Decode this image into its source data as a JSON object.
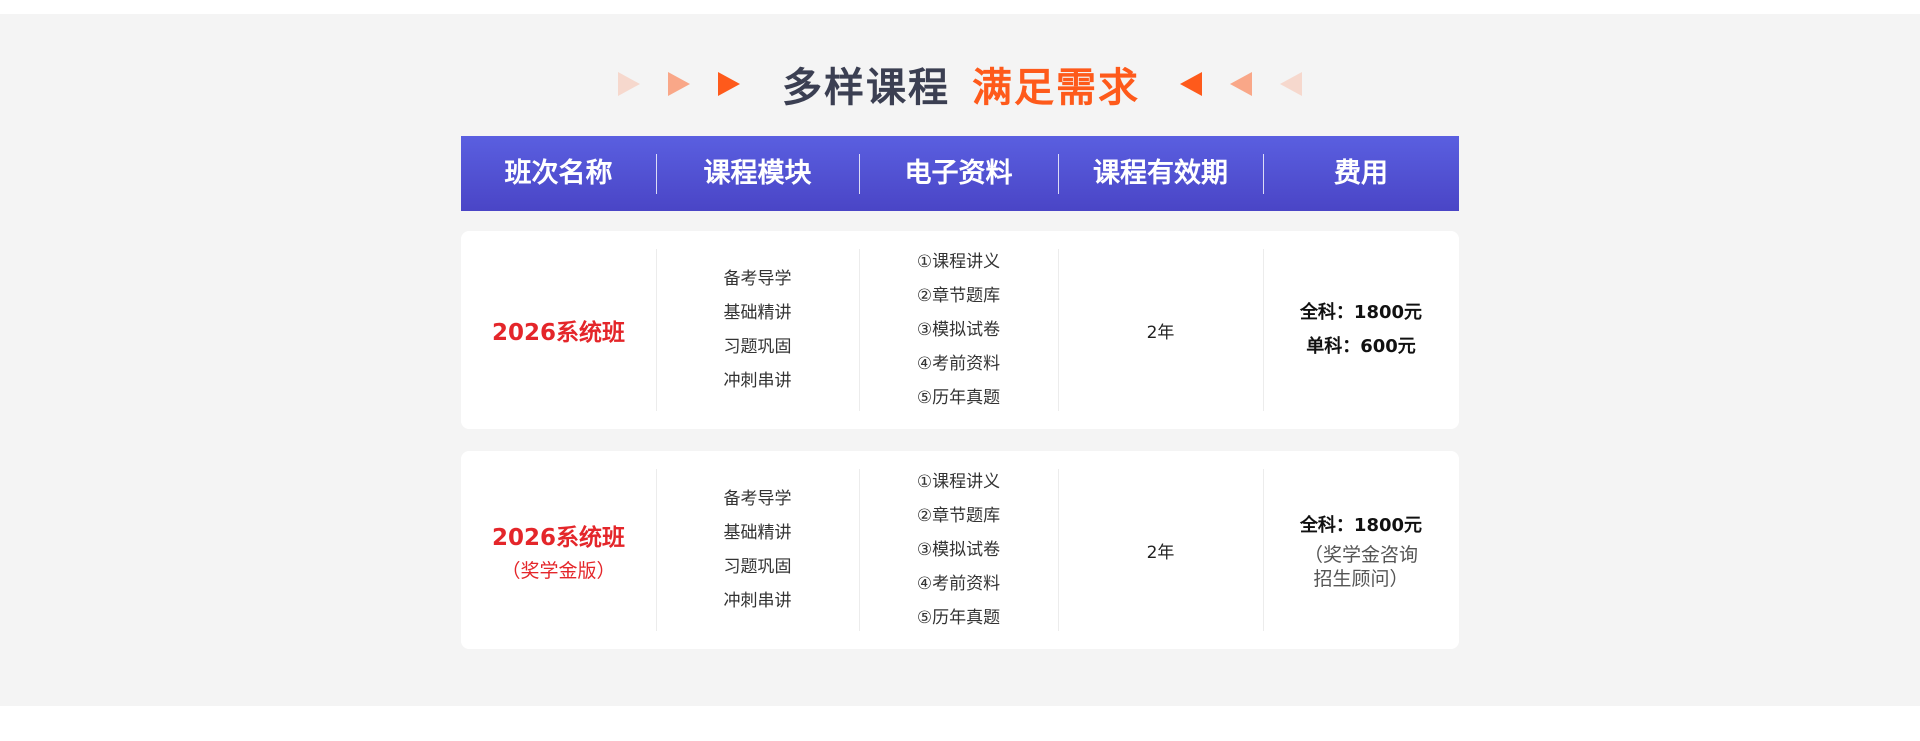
{
  "headline": {
    "title_dark": "多样课程",
    "title_accent": "满足需求"
  },
  "table": {
    "headers": [
      "班次名称",
      "课程模块",
      "电子资料",
      "课程有效期",
      "费用"
    ],
    "rows": [
      {
        "name": "2026系统班",
        "subtitle": "",
        "modules": [
          "备考导学",
          "基础精讲",
          "习题巩固",
          "冲刺串讲"
        ],
        "materials": [
          "①课程讲义",
          "②章节题库",
          "③模拟试卷",
          "④考前资料",
          "⑤历年真题"
        ],
        "validity": "2年",
        "fee_lines": [
          "全科：1800元",
          "单科：600元"
        ],
        "fee_note": ""
      },
      {
        "name": "2026系统班",
        "subtitle": "（奖学金版）",
        "modules": [
          "备考导学",
          "基础精讲",
          "习题巩固",
          "冲刺串讲"
        ],
        "materials": [
          "①课程讲义",
          "②章节题库",
          "③模拟试卷",
          "④考前资料",
          "⑤历年真题"
        ],
        "validity": "2年",
        "fee_lines": [
          "全科：1800元"
        ],
        "fee_note": "（奖学金咨询招生顾问）"
      }
    ]
  },
  "colors": {
    "accent": "#fe5a1b",
    "header_start": "#5a5fe0",
    "header_end": "#4a45c6",
    "class_name": "#e4262a",
    "background": "#f4f4f4"
  }
}
